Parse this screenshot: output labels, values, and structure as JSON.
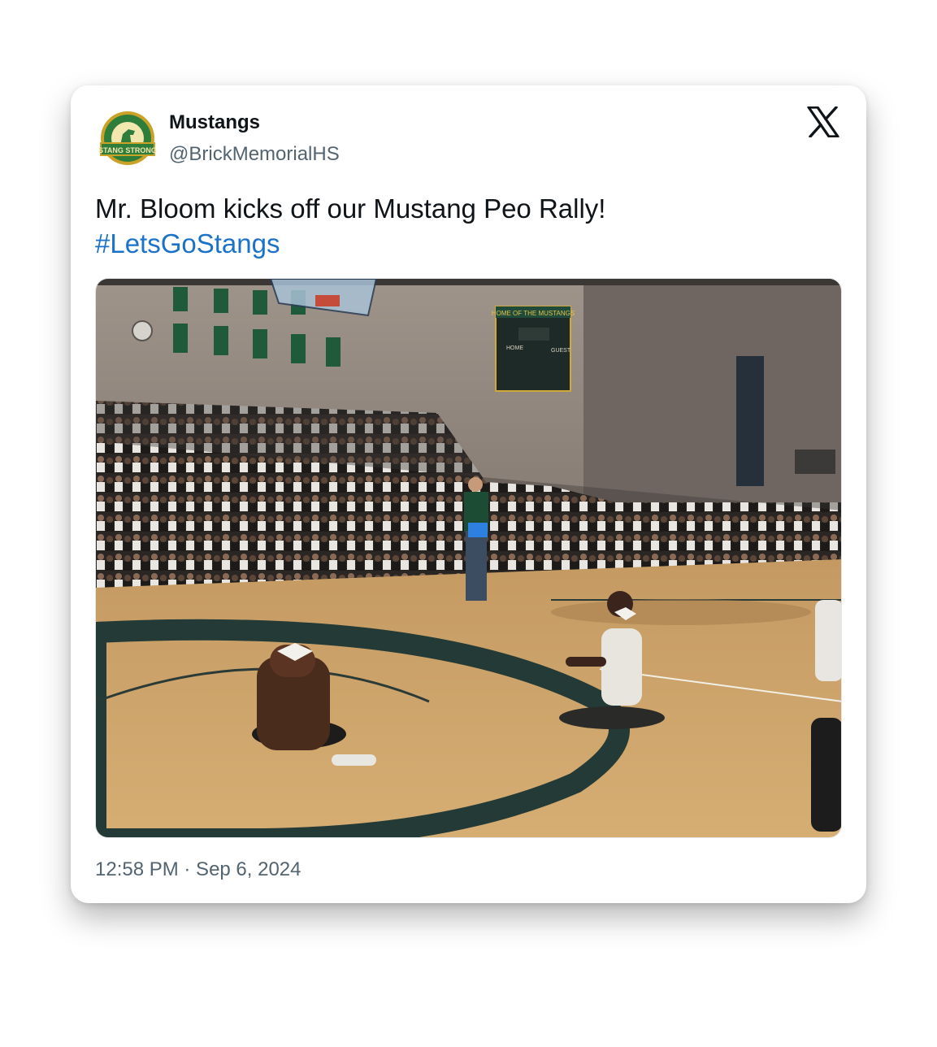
{
  "account": {
    "display_name": "Mustangs",
    "handle": "@BrickMemorialHS",
    "avatar_icon": "school-badge-icon",
    "avatar_banner_text": "STANG STRONG"
  },
  "platform_icon": "x-logo-icon",
  "tweet": {
    "text": "Mr. Bloom kicks off our Mustang Peo Rally!",
    "hashtag": "#LetsGoStangs",
    "hashtag_color": "#1a73c9"
  },
  "media": {
    "scoreboard_title": "HOME OF THE MUSTANGS",
    "scoreboard_home": "HOME",
    "scoreboard_guest": "GUEST"
  },
  "timestamp": "12:58 PM · Sep 6, 2024"
}
